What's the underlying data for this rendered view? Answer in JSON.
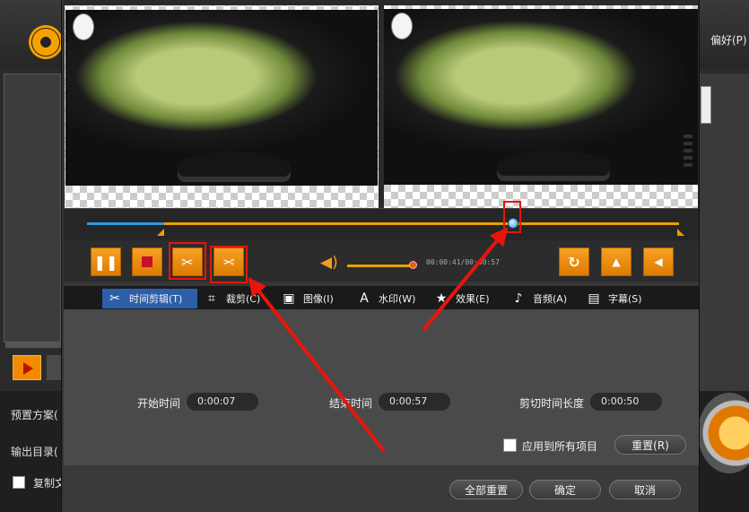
{
  "app": {
    "menu_preferences": "偏好(P)",
    "preset_label": "预置方案(",
    "output_dir_label": "输出目录(",
    "copy_label": "复制文"
  },
  "player": {
    "time_display": "00:00:41/00:00:57",
    "volume_percent": 100,
    "timeline_progress_fraction": 0.13,
    "playhead_fraction": 0.72
  },
  "tabs": [
    {
      "label": "时间剪辑(T)",
      "icon": "scissors-icon",
      "active": true
    },
    {
      "label": "裁剪(C)",
      "icon": "crop-icon",
      "active": false
    },
    {
      "label": "图像(I)",
      "icon": "image-icon",
      "active": false
    },
    {
      "label": "水印(W)",
      "icon": "watermark-icon",
      "active": false
    },
    {
      "label": "效果(E)",
      "icon": "star-icon",
      "active": false
    },
    {
      "label": "音频(A)",
      "icon": "music-note-icon",
      "active": false
    },
    {
      "label": "字幕(S)",
      "icon": "subtitle-icon",
      "active": false
    }
  ],
  "trim": {
    "start_label": "开始时间",
    "start_value": "0:00:07",
    "end_label": "结束时间",
    "end_value": "0:00:57",
    "duration_label": "剪切时间长度",
    "duration_value": "0:00:50",
    "apply_all_label": "应用到所有项目",
    "reset_button": "重置(R)"
  },
  "footer": {
    "reset_all": "全部重置",
    "ok": "确定",
    "cancel": "取消"
  },
  "colors": {
    "accent_orange": "#f08a00",
    "active_tab_blue": "#2c5fa8",
    "annotation_red": "#e8150b",
    "progress_blue": "#2b9be4"
  }
}
